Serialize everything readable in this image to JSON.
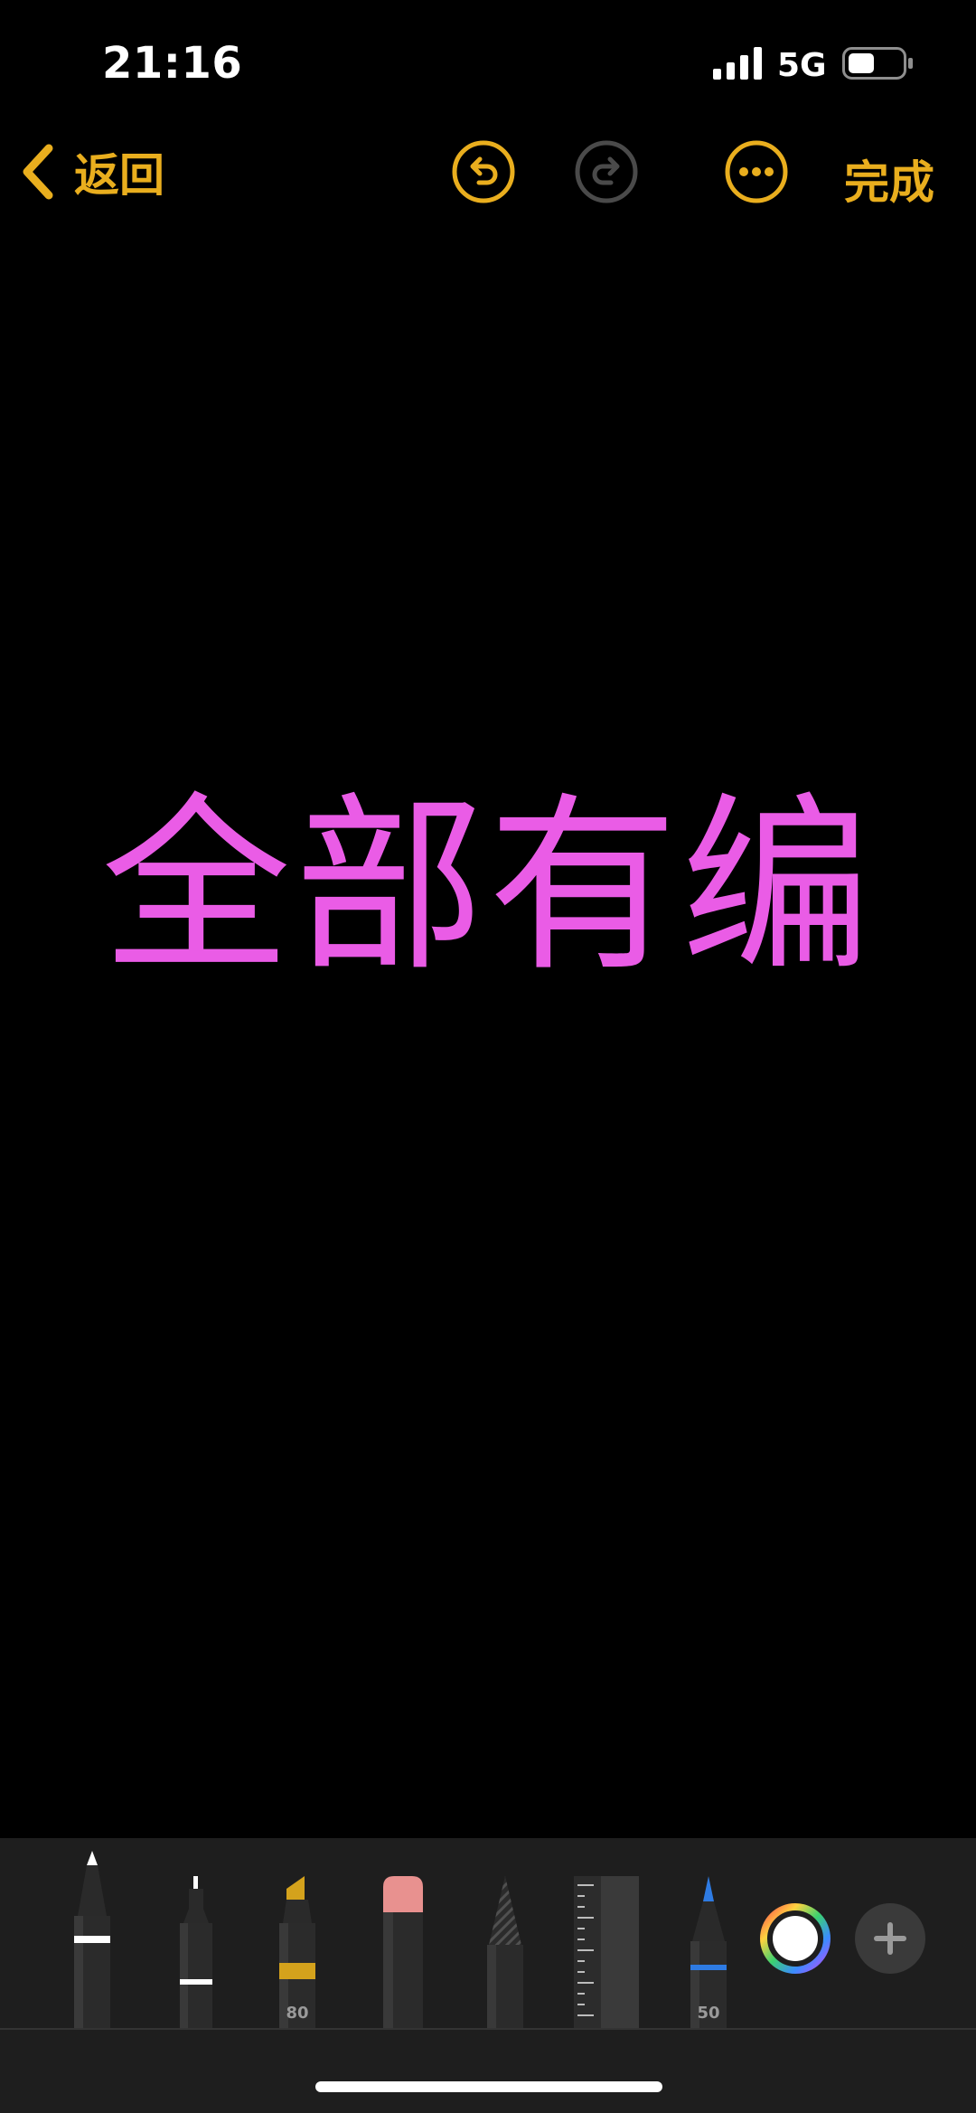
{
  "status_bar": {
    "time": "21:16",
    "network": "5G",
    "signal_icon": "cellular-signal-icon",
    "battery_icon": "battery-icon"
  },
  "nav": {
    "back_label": "返回",
    "done_label": "完成",
    "icons": {
      "back": "chevron-left-icon",
      "undo": "undo-icon",
      "redo": "redo-icon",
      "more": "ellipsis-circle-icon"
    }
  },
  "canvas": {
    "handwriting_text": "全部有编"
  },
  "toolbar": {
    "tools": [
      {
        "name": "pen",
        "icon": "pen-icon",
        "label": ""
      },
      {
        "name": "fineliner",
        "icon": "fineliner-icon",
        "label": ""
      },
      {
        "name": "highlighter",
        "icon": "highlighter-icon",
        "label": "80"
      },
      {
        "name": "eraser",
        "icon": "eraser-icon",
        "label": ""
      },
      {
        "name": "pencil",
        "icon": "pencil-icon",
        "label": ""
      },
      {
        "name": "ruler",
        "icon": "ruler-icon",
        "label": ""
      },
      {
        "name": "crayon",
        "icon": "crayon-icon",
        "label": "50"
      }
    ],
    "color_picker_icon": "color-wheel-icon",
    "add_icon": "plus-icon"
  },
  "colors": {
    "accent": "#E9AE1E",
    "ink": "#EA5CE6",
    "toolbar_bg": "#1E1E1E",
    "highlighter": "#D4A21C",
    "eraser_top": "#E8918F",
    "crayon_tip": "#2E7BE3"
  }
}
